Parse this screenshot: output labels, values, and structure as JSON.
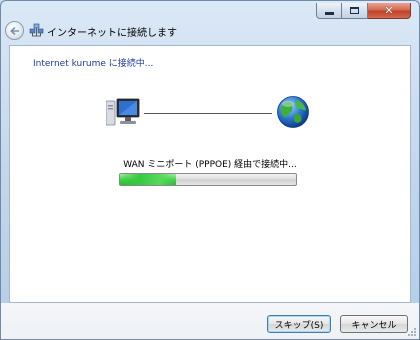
{
  "window": {
    "title": "インターネットに接続します",
    "caption_buttons": [
      "minimize",
      "maximize",
      "close"
    ]
  },
  "header": {
    "back_icon": "back-arrow-icon",
    "app_icon": "network-connection-icon"
  },
  "main": {
    "heading": "Internet kurume に接続中...",
    "status_text": "WAN ミニポート (PPPOE) 経由で接続中...",
    "progress_state": "indeterminate",
    "left_icon": "computer-icon",
    "right_icon": "globe-icon"
  },
  "footer": {
    "skip_label": "スキップ(S)",
    "cancel_label": "キャンセル"
  },
  "colors": {
    "heading": "#1f3c9a",
    "progress": "#3fcf46",
    "close_button": "#c0432a"
  }
}
